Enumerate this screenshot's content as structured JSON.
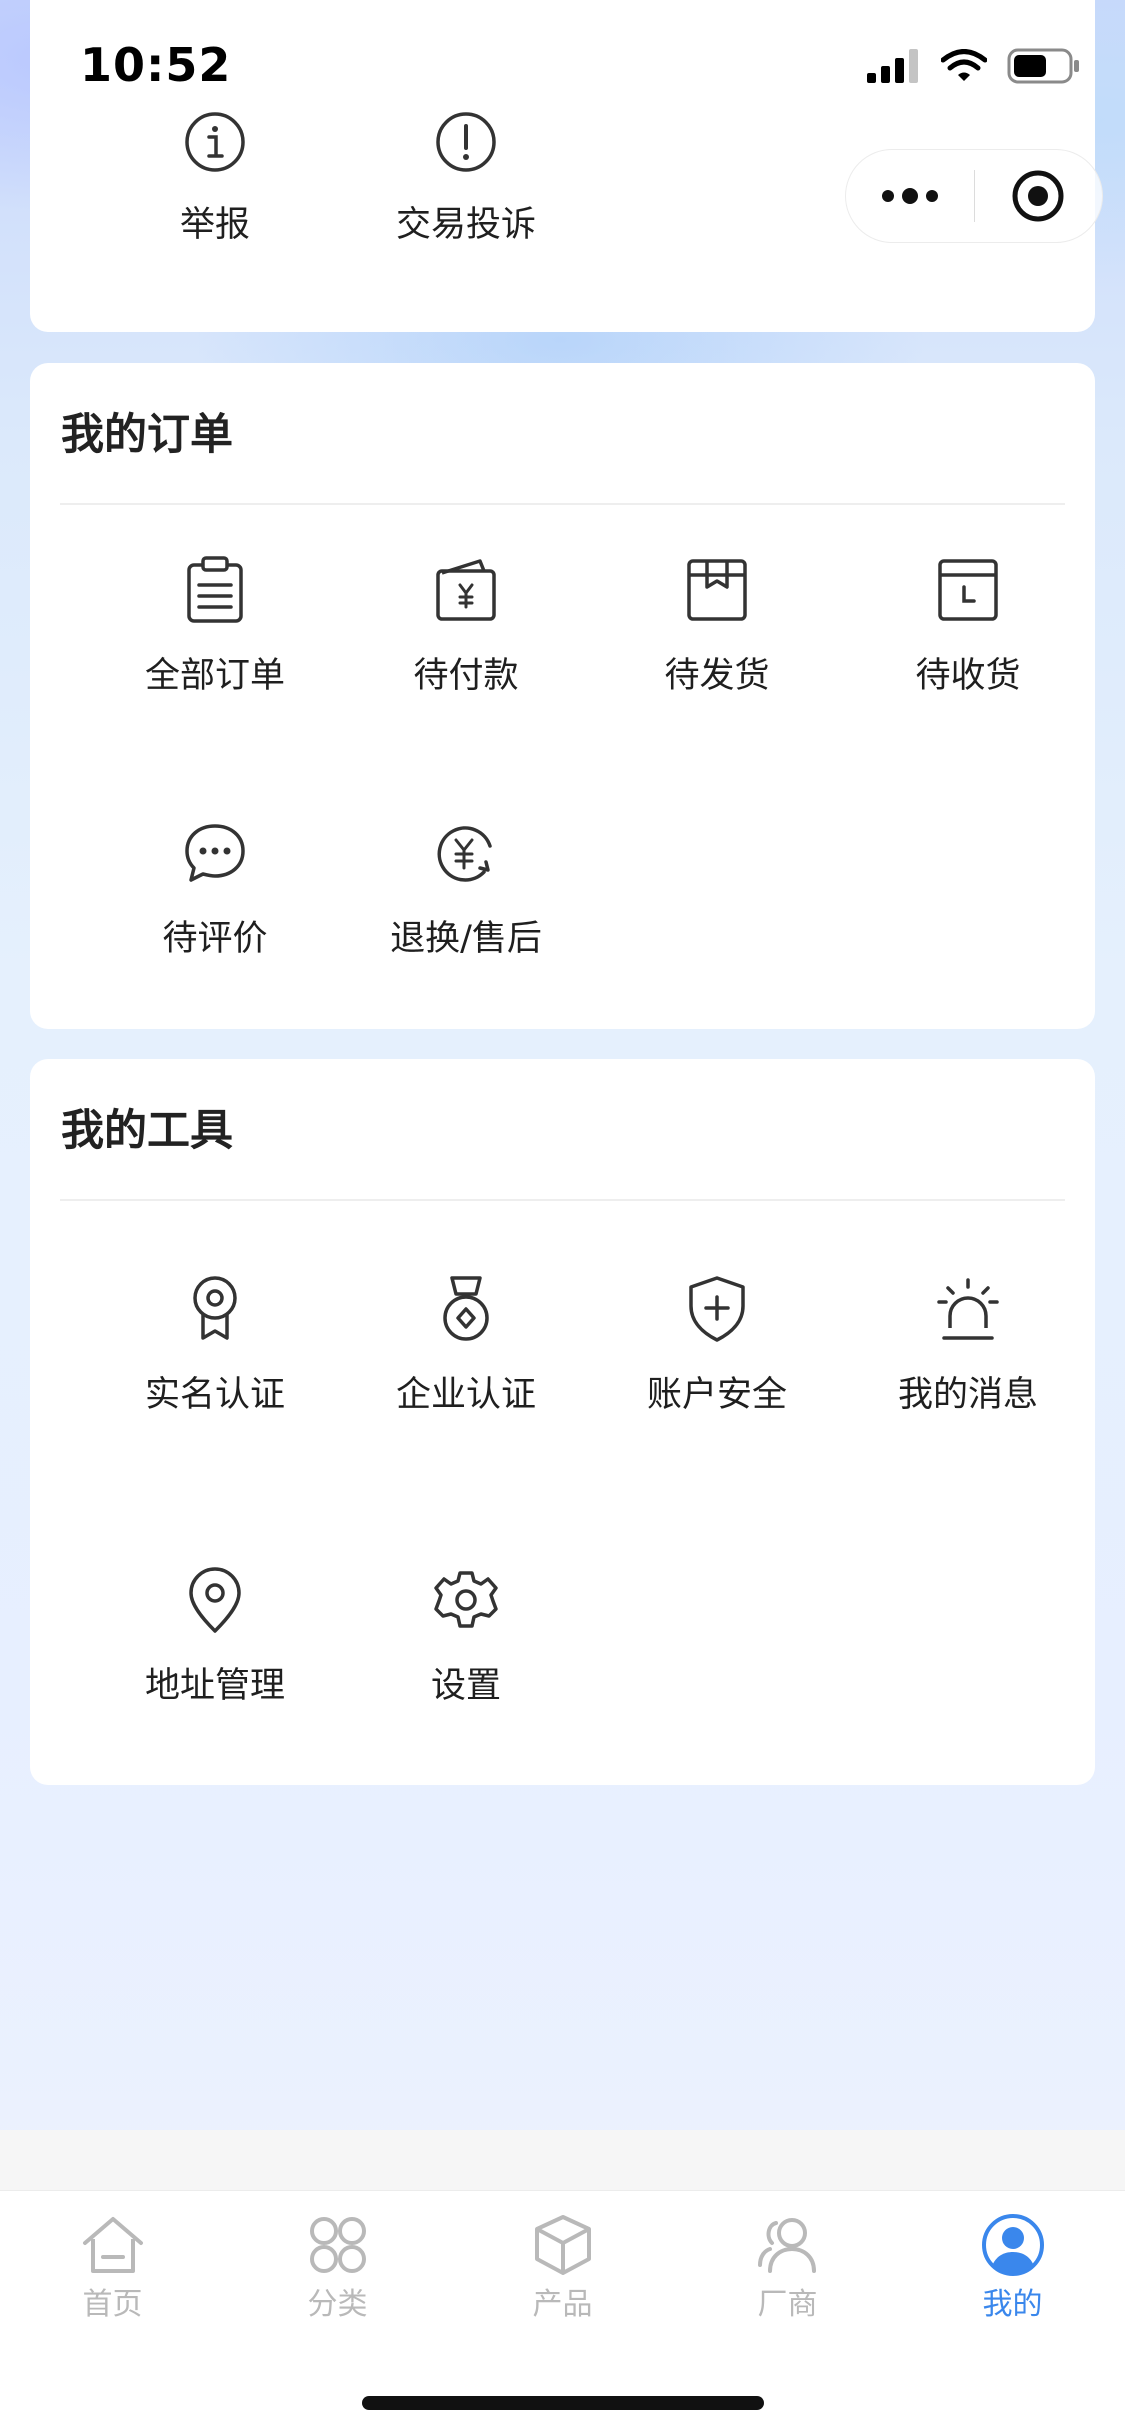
{
  "status_bar": {
    "time": "10:52"
  },
  "top_section": {
    "items": [
      {
        "label": "举报",
        "icon": "info-circle-icon"
      },
      {
        "label": "交易投诉",
        "icon": "exclamation-circle-icon"
      }
    ]
  },
  "orders": {
    "title": "我的订单",
    "items": [
      {
        "label": "全部订单",
        "icon": "clipboard-icon"
      },
      {
        "label": "待付款",
        "icon": "wallet-yuan-icon"
      },
      {
        "label": "待发货",
        "icon": "box-icon"
      },
      {
        "label": "待收货",
        "icon": "box-clock-icon"
      },
      {
        "label": "待评价",
        "icon": "chat-bubble-icon"
      },
      {
        "label": "退换/售后",
        "icon": "yuan-refund-icon"
      }
    ]
  },
  "tools": {
    "title": "我的工具",
    "items": [
      {
        "label": "实名认证",
        "icon": "certificate-icon"
      },
      {
        "label": "企业认证",
        "icon": "medal-icon"
      },
      {
        "label": "账户安全",
        "icon": "shield-plus-icon"
      },
      {
        "label": "我的消息",
        "icon": "alarm-icon"
      },
      {
        "label": "地址管理",
        "icon": "location-pin-icon"
      },
      {
        "label": "设置",
        "icon": "gear-icon"
      }
    ]
  },
  "tabbar": {
    "items": [
      {
        "label": "首页",
        "icon": "home-icon",
        "active": false
      },
      {
        "label": "分类",
        "icon": "category-icon",
        "active": false
      },
      {
        "label": "产品",
        "icon": "cube-icon",
        "active": false
      },
      {
        "label": "厂商",
        "icon": "users-icon",
        "active": false
      },
      {
        "label": "我的",
        "icon": "user-circle-icon",
        "active": true
      }
    ]
  },
  "colors": {
    "accent": "#3a87ec",
    "inactive_tab": "#b9b9b9",
    "icon_stroke": "#333333"
  }
}
